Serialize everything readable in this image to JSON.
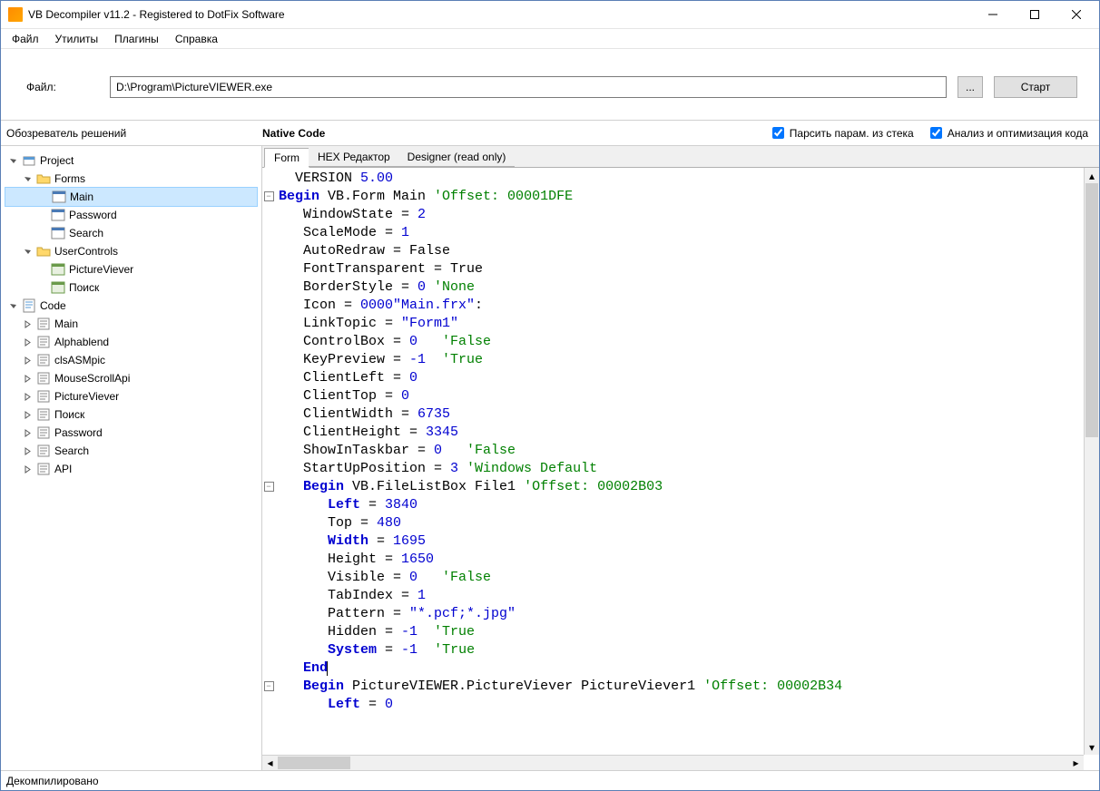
{
  "window": {
    "title": "VB Decompiler v11.2 - Registered to DotFix Software"
  },
  "menu": [
    "Файл",
    "Утилиты",
    "Плагины",
    "Справка"
  ],
  "filebar": {
    "label": "Файл:",
    "path": "D:\\Program\\PictureVIEWER.exe",
    "browse": "...",
    "start": "Старт"
  },
  "secondbar": {
    "solutions": "Обозреватель решений",
    "native": "Native Code",
    "chk1": "Парсить парам. из стека",
    "chk2": "Анализ и оптимизация кода"
  },
  "tree": {
    "project": "Project",
    "forms": "Forms",
    "forms_items": [
      "Main",
      "Password",
      "Search"
    ],
    "usercontrols": "UserControls",
    "uc_items": [
      "PictureViever",
      "Поиск"
    ],
    "code": "Code",
    "code_items": [
      "Main",
      "Alphablend",
      "clsASMpic",
      "MouseScrollApi",
      "PictureViever",
      "Поиск",
      "Password",
      "Search",
      "API"
    ]
  },
  "tabs": [
    "Form",
    "HEX Редактор",
    "Designer (read only)"
  ],
  "code_lines": [
    {
      "t": "  VERSION ",
      "n": "5.00"
    },
    {
      "fold": true,
      "b": "Begin",
      "t": " VB.Form Main ",
      "g": "'Offset: 00001DFE"
    },
    {
      "t": "   WindowState = ",
      "n": "2"
    },
    {
      "t": "   ScaleMode = ",
      "n": "1"
    },
    {
      "t": "   AutoRedraw = False"
    },
    {
      "t": "   FontTransparent = True"
    },
    {
      "t": "   BorderStyle = ",
      "n": "0",
      "g": " 'None"
    },
    {
      "t": "   Icon = ",
      "s": "\"Main.frx\"",
      "t2": ":",
      "n": "0000"
    },
    {
      "t": "   LinkTopic = ",
      "s": "\"Form1\""
    },
    {
      "t": "   ControlBox = ",
      "n": "0",
      "g": "   'False"
    },
    {
      "t": "   KeyPreview = ",
      "n": "-1",
      "g": "  'True"
    },
    {
      "t": "   ClientLeft = ",
      "n": "0"
    },
    {
      "t": "   ClientTop = ",
      "n": "0"
    },
    {
      "t": "   ClientWidth = ",
      "n": "6735"
    },
    {
      "t": "   ClientHeight = ",
      "n": "3345"
    },
    {
      "t": "   ShowInTaskbar = ",
      "n": "0",
      "g": "   'False"
    },
    {
      "t": "   StartUpPosition = ",
      "n": "3",
      "g": " 'Windows Default"
    },
    {
      "fold": true,
      "pre": "   ",
      "b": "Begin",
      "t": " VB.FileListBox File1 ",
      "g": "'Offset: 00002B03"
    },
    {
      "pre": "      ",
      "b": "Left",
      "t": " = ",
      "n": "3840"
    },
    {
      "t": "      Top = ",
      "n": "480"
    },
    {
      "pre": "      ",
      "b": "Width",
      "t": " = ",
      "n": "1695"
    },
    {
      "t": "      Height = ",
      "n": "1650"
    },
    {
      "t": "      Visible = ",
      "n": "0",
      "g": "   'False"
    },
    {
      "t": "      TabIndex = ",
      "n": "1"
    },
    {
      "t": "      Pattern = ",
      "s": "\"*.pcf;*.jpg\""
    },
    {
      "t": "      Hidden = ",
      "n": "-1",
      "g": "  'True"
    },
    {
      "pre": "      ",
      "b": "System",
      "t": " = ",
      "n": "-1",
      "g": "  'True"
    },
    {
      "pre": "   ",
      "b": "End",
      "caret": true
    },
    {
      "fold": true,
      "pre": "   ",
      "b": "Begin",
      "t": " PictureVIEWER.PictureViever PictureViever1 ",
      "g": "'Offset: 00002B34"
    },
    {
      "pre": "      ",
      "b": "Left",
      "t": " = ",
      "n": "0"
    }
  ],
  "status": "Декомпилировано"
}
